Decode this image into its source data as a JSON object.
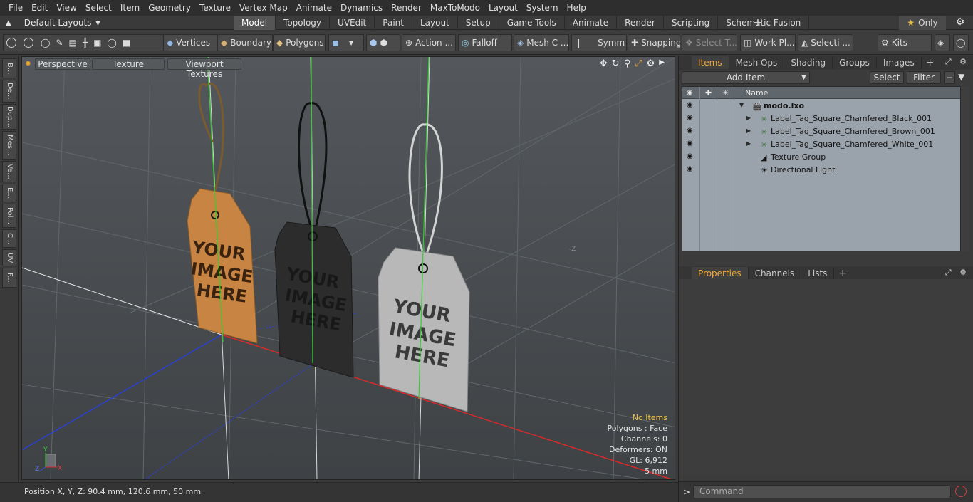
{
  "menu": [
    "File",
    "Edit",
    "View",
    "Select",
    "Item",
    "Geometry",
    "Texture",
    "Vertex Map",
    "Animate",
    "Dynamics",
    "Render",
    "MaxToModo",
    "Layout",
    "System",
    "Help"
  ],
  "layout_select": "Default Layouts",
  "layout_tabs": [
    "Model",
    "Topology",
    "UVEdit",
    "Paint",
    "Layout",
    "Setup",
    "Game Tools",
    "Animate",
    "Render",
    "Scripting",
    "Schematic Fusion"
  ],
  "active_layout_tab": "Model",
  "only_label": "Only",
  "toolbar": {
    "vertices": "Vertices",
    "boundary": "Boundary",
    "polygons": "Polygons",
    "action": "Action ...",
    "falloff": "Falloff",
    "mesh": "Mesh C ...",
    "symm": "Symm ...",
    "snapping": "Snapping",
    "select_t": "Select T...",
    "work_pl": "Work Pl...",
    "selecti": "Selecti ...",
    "kits": "Kits"
  },
  "left_tabs": [
    "B...",
    "De...",
    "Dup...",
    "Mes...",
    "Ve...",
    "E...",
    "Pol...",
    "C...",
    "UV",
    "F..."
  ],
  "viewport": {
    "perspective": "Perspective",
    "texture": "Texture",
    "viewport_textures": "Viewport Textures",
    "tag_text": [
      "YOUR",
      "IMAGE",
      "HERE"
    ],
    "info": {
      "no_items": "No Items",
      "polygons": "Polygons : Face",
      "channels": "Channels: 0",
      "deformers": "Deformers: ON",
      "gl": "GL: 6,912",
      "scale": "5 mm"
    },
    "axis_neg_z": "-Z",
    "axis_y": "Y",
    "axis_z": "Z",
    "axis_x": "X"
  },
  "status": {
    "position": "Position X, Y, Z:  90.4 mm, 120.6 mm, 50 mm"
  },
  "items_panel": {
    "tabs": [
      "Items",
      "Mesh Ops",
      "Shading",
      "Groups",
      "Images"
    ],
    "active_tab": "Items",
    "add_item": "Add Item",
    "select": "Select",
    "filter": "Filter",
    "name_header": "Name",
    "rows": [
      {
        "label": "modo.lxo",
        "indent": 0,
        "bold": true,
        "icon": "scene-icon"
      },
      {
        "label": "Label_Tag_Square_Chamfered_Black_001",
        "indent": 1,
        "bold": false,
        "icon": "mesh-icon"
      },
      {
        "label": "Label_Tag_Square_Chamfered_Brown_001",
        "indent": 1,
        "bold": false,
        "icon": "mesh-icon"
      },
      {
        "label": "Label_Tag_Square_Chamfered_White_001",
        "indent": 1,
        "bold": false,
        "icon": "mesh-icon"
      },
      {
        "label": "Texture Group",
        "indent": 1,
        "bold": false,
        "icon": "texture-group-icon"
      },
      {
        "label": "Directional Light",
        "indent": 1,
        "bold": false,
        "icon": "light-icon"
      }
    ]
  },
  "properties_panel": {
    "tabs": [
      "Properties",
      "Channels",
      "Lists"
    ],
    "active_tab": "Properties"
  },
  "command": {
    "prompt": ">",
    "placeholder": "Command"
  }
}
